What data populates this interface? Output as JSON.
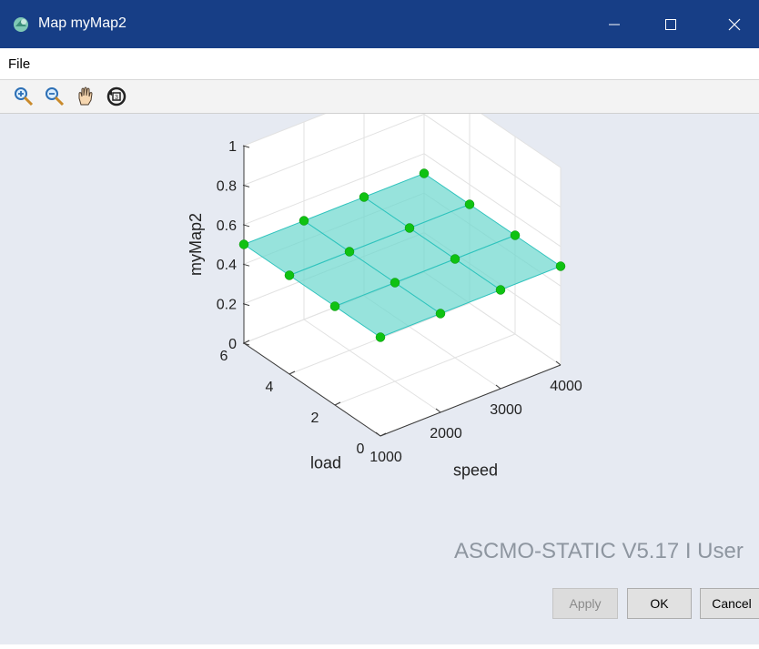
{
  "window": {
    "title": "Map myMap2"
  },
  "menu": {
    "file_label": "File"
  },
  "toolbar": {
    "tools": [
      "zoom-in-icon",
      "zoom-out-icon",
      "pan-hand-icon",
      "rotate-3d-icon"
    ]
  },
  "watermark": "ASCMO-STATIC V5.17 I User",
  "buttons": {
    "apply": "Apply",
    "ok": "OK",
    "cancel": "Cancel"
  },
  "chart_data": {
    "type": "surface3d",
    "zlabel": "myMap2",
    "xlabel": "speed",
    "ylabel": "load",
    "z_ticks": [
      "0",
      "0.2",
      "0.4",
      "0.6",
      "0.8",
      "1"
    ],
    "x_ticks": [
      "1000",
      "2000",
      "3000",
      "4000"
    ],
    "y_ticks": [
      "0",
      "2",
      "4",
      "6"
    ],
    "zlim": [
      0,
      1
    ],
    "xlim": [
      1000,
      4000
    ],
    "ylim": [
      0,
      6
    ],
    "grid": true,
    "surface_color": "#6fd8cf",
    "point_color": "#0fc212",
    "speed": [
      1000,
      2000,
      3000,
      4000
    ],
    "load": [
      0,
      2,
      4,
      6
    ],
    "values": [
      [
        0.5,
        0.5,
        0.5,
        0.5
      ],
      [
        0.5,
        0.5,
        0.5,
        0.5
      ],
      [
        0.5,
        0.5,
        0.5,
        0.5
      ],
      [
        0.5,
        0.5,
        0.5,
        0.5
      ]
    ]
  }
}
